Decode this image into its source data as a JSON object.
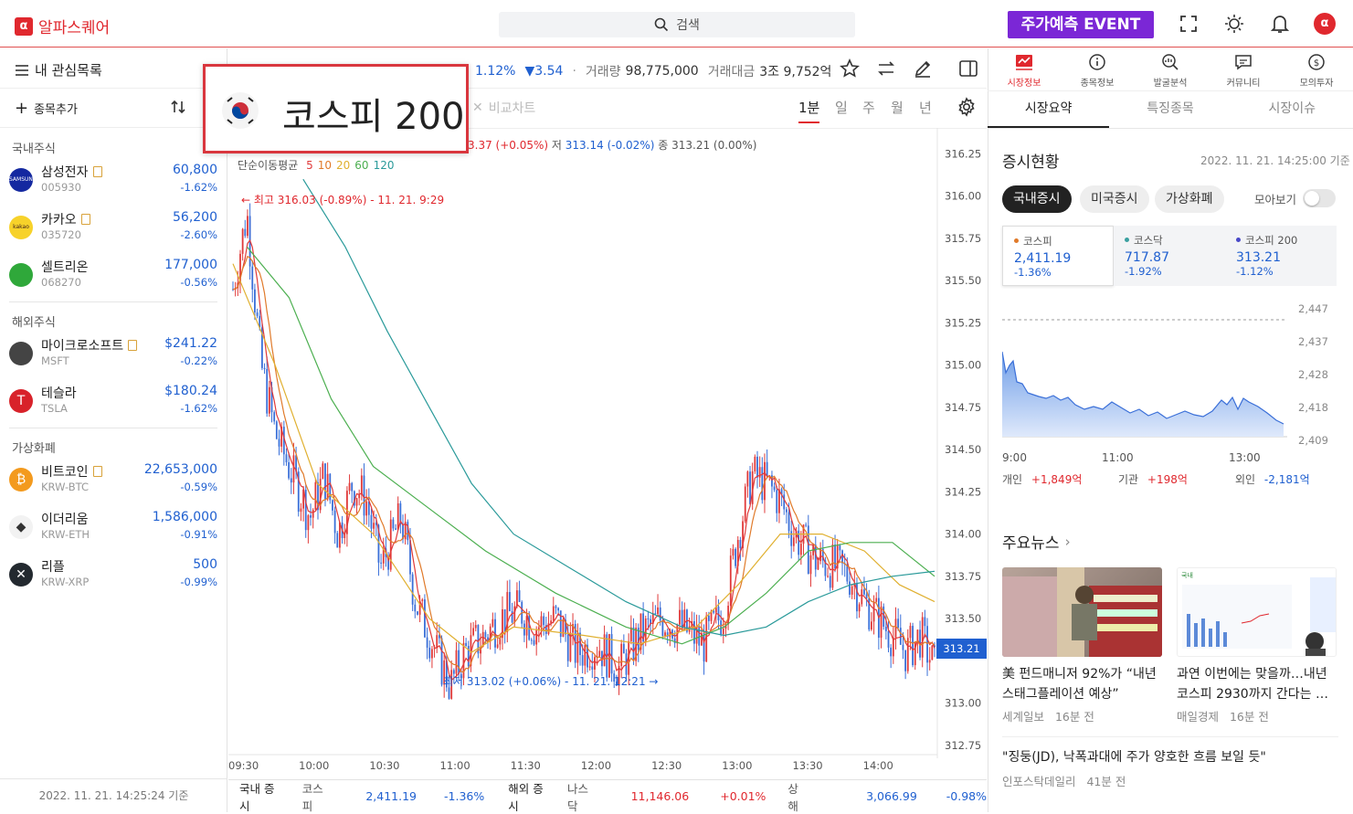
{
  "header": {
    "logo_label": "알파스퀘어",
    "logo_glyph": "α",
    "search_placeholder": "검색",
    "event_label": "주가예측 EVENT",
    "avatar_glyph": "α"
  },
  "watchlist": {
    "title": "내 관심목록",
    "add_label": "종목추가",
    "sections": [
      {
        "title": "국내주식",
        "items": [
          {
            "name": "삼성전자",
            "code": "005930",
            "price": "60,800",
            "change": "-1.62%",
            "logo_text": "SAMSUNG",
            "logo_color": "#1428a0",
            "doc": true
          },
          {
            "name": "카카오",
            "code": "035720",
            "price": "56,200",
            "change": "-2.60%",
            "logo_text": "kakao",
            "logo_color": "#f7d22a",
            "doc": true
          },
          {
            "name": "셀트리온",
            "code": "068270",
            "price": "177,000",
            "change": "-0.56%",
            "logo_text": "",
            "logo_color": "#2fa83a",
            "doc": false
          }
        ]
      },
      {
        "title": "해외주식",
        "items": [
          {
            "name": "마이크로소프트",
            "code": "MSFT",
            "price": "$241.22",
            "change": "-0.22%",
            "logo_text": "",
            "logo_color": "#444",
            "doc": true
          },
          {
            "name": "테슬라",
            "code": "TSLA",
            "price": "$180.24",
            "change": "-1.62%",
            "logo_text": "T",
            "logo_color": "#d8222a",
            "doc": false
          }
        ]
      },
      {
        "title": "가상화폐",
        "items": [
          {
            "name": "비트코인",
            "code": "KRW-BTC",
            "price": "22,653,000",
            "change": "-0.59%",
            "logo_text": "₿",
            "logo_color": "#f39a1e",
            "doc": true
          },
          {
            "name": "이더리움",
            "code": "KRW-ETH",
            "price": "1,586,000",
            "change": "-0.91%",
            "logo_text": "◆",
            "logo_color": "#f2f2f2",
            "doc": false
          },
          {
            "name": "리플",
            "code": "KRW-XRP",
            "price": "500",
            "change": "-0.99%",
            "logo_text": "✕",
            "logo_color": "#23292f",
            "doc": false
          }
        ]
      }
    ],
    "footer_time": "2022. 11. 21. 14:25:24 기준"
  },
  "chart_header": {
    "name": "코스피 200",
    "change_pct": "1.12%",
    "change_abs": "▼3.54",
    "volume_label": "거래량",
    "volume": "98,775,000",
    "value_label": "거래대금",
    "value": "3조 9,752억",
    "compare_label": "비교차트",
    "periods": [
      "1분",
      "일",
      "주",
      "월",
      "년"
    ],
    "active_period": "1분",
    "ohlc_text": "3.37 (+0.05%)",
    "low_label": "저",
    "low_text": "313.14 (-0.02%)",
    "close_label": "종",
    "close_text": "313.21 (0.00%)",
    "ma_label": "단순이동평균",
    "ma_periods": [
      "5",
      "10",
      "20",
      "60",
      "120"
    ],
    "ma_colors": [
      "#e03a3a",
      "#e07a2a",
      "#e0b030",
      "#4caf50",
      "#2a9a9a"
    ],
    "high_annotation": "← 최고 316.03 (-0.89%) - 11. 21. 9:29",
    "low_annotation": "최저 313.02 (+0.06%) - 11. 21. 12:21 →",
    "current_price_tag": "313.21"
  },
  "chart_data": {
    "type": "candlestick",
    "y_ticks": [
      "316.25",
      "316.00",
      "315.75",
      "315.50",
      "315.25",
      "315.00",
      "314.75",
      "314.50",
      "314.25",
      "314.00",
      "313.75",
      "313.50",
      "313.21",
      "313.00",
      "312.75"
    ],
    "x_ticks": [
      "09:30",
      "10:00",
      "10:30",
      "11:00",
      "11:30",
      "12:00",
      "12:30",
      "13:00",
      "13:30",
      "14:00"
    ],
    "ylim": [
      312.7,
      316.35
    ],
    "high": 316.03,
    "low": 313.02,
    "last": 313.21,
    "price_path": [
      [
        0,
        315.45
      ],
      [
        0.02,
        315.9
      ],
      [
        0.04,
        315.0
      ],
      [
        0.06,
        314.6
      ],
      [
        0.08,
        314.4
      ],
      [
        0.11,
        314.1
      ],
      [
        0.13,
        314.35
      ],
      [
        0.15,
        314.0
      ],
      [
        0.17,
        314.3
      ],
      [
        0.19,
        314.2
      ],
      [
        0.21,
        313.8
      ],
      [
        0.24,
        314.1
      ],
      [
        0.26,
        313.6
      ],
      [
        0.29,
        313.3
      ],
      [
        0.31,
        313.1
      ],
      [
        0.33,
        313.3
      ],
      [
        0.36,
        313.4
      ],
      [
        0.38,
        313.5
      ],
      [
        0.41,
        313.55
      ],
      [
        0.43,
        313.45
      ],
      [
        0.46,
        313.5
      ],
      [
        0.49,
        313.3
      ],
      [
        0.52,
        313.35
      ],
      [
        0.55,
        313.2
      ],
      [
        0.58,
        313.4
      ],
      [
        0.61,
        313.5
      ],
      [
        0.64,
        313.45
      ],
      [
        0.67,
        313.35
      ],
      [
        0.7,
        313.55
      ],
      [
        0.72,
        314.0
      ],
      [
        0.74,
        314.35
      ],
      [
        0.76,
        314.3
      ],
      [
        0.78,
        314.2
      ],
      [
        0.8,
        314.0
      ],
      [
        0.83,
        313.85
      ],
      [
        0.86,
        313.8
      ],
      [
        0.88,
        313.75
      ],
      [
        0.9,
        313.6
      ],
      [
        0.93,
        313.45
      ],
      [
        0.96,
        313.3
      ],
      [
        0.98,
        313.4
      ],
      [
        1,
        313.21
      ]
    ],
    "ma_paths": [
      {
        "name": "20",
        "color": "#e0b030",
        "points": [
          [
            0,
            315.6
          ],
          [
            0.06,
            315.0
          ],
          [
            0.12,
            314.3
          ],
          [
            0.2,
            314.0
          ],
          [
            0.28,
            313.5
          ],
          [
            0.34,
            313.3
          ],
          [
            0.4,
            313.45
          ],
          [
            0.5,
            313.4
          ],
          [
            0.58,
            313.35
          ],
          [
            0.66,
            313.45
          ],
          [
            0.72,
            313.7
          ],
          [
            0.78,
            314.0
          ],
          [
            0.84,
            314.0
          ],
          [
            0.9,
            313.9
          ],
          [
            0.95,
            313.7
          ],
          [
            1,
            313.6
          ]
        ]
      },
      {
        "name": "60",
        "color": "#4caf50",
        "points": [
          [
            0.02,
            315.7
          ],
          [
            0.08,
            315.4
          ],
          [
            0.14,
            314.8
          ],
          [
            0.2,
            314.4
          ],
          [
            0.28,
            314.15
          ],
          [
            0.36,
            313.9
          ],
          [
            0.46,
            313.65
          ],
          [
            0.56,
            313.45
          ],
          [
            0.64,
            313.35
          ],
          [
            0.7,
            313.45
          ],
          [
            0.76,
            313.65
          ],
          [
            0.82,
            313.9
          ],
          [
            0.88,
            313.95
          ],
          [
            0.94,
            313.95
          ],
          [
            1,
            313.75
          ]
        ]
      },
      {
        "name": "120",
        "color": "#2a9a9a",
        "points": [
          [
            0.1,
            316.1
          ],
          [
            0.16,
            315.7
          ],
          [
            0.22,
            315.2
          ],
          [
            0.28,
            314.75
          ],
          [
            0.34,
            314.3
          ],
          [
            0.4,
            314.0
          ],
          [
            0.48,
            313.8
          ],
          [
            0.56,
            313.6
          ],
          [
            0.64,
            313.45
          ],
          [
            0.7,
            313.4
          ],
          [
            0.76,
            313.45
          ],
          [
            0.82,
            313.6
          ],
          [
            0.88,
            313.7
          ],
          [
            0.94,
            313.75
          ],
          [
            1,
            313.78
          ]
        ]
      }
    ]
  },
  "bottom_bar": {
    "domestic_label": "국내 증시",
    "items": [
      {
        "name": "코스피",
        "value": "2,411.19",
        "change": "-1.36%",
        "color": "#2060d0"
      }
    ],
    "overseas_label": "해외 증시",
    "overseas_items": [
      {
        "name": "나스닥",
        "value": "11,146.06",
        "change": "+0.01%",
        "color": "#e0282e"
      },
      {
        "name": "상해",
        "value": "3,066.99",
        "change": "-0.98%",
        "color": "#2060d0"
      }
    ]
  },
  "right_panel": {
    "tabs": [
      "시장정보",
      "종목정보",
      "발굴분석",
      "커뮤니티",
      "모의투자"
    ],
    "sub_tabs": [
      "시장요약",
      "특징종목",
      "시장이슈"
    ],
    "market_title": "증시현황",
    "market_time": "2022. 11. 21. 14:25:00 기준",
    "pills": [
      "국내증시",
      "미국증시",
      "가상화폐"
    ],
    "collect_label": "모아보기",
    "indices": [
      {
        "name": "코스피",
        "value": "2,411.19",
        "change": "-1.36%",
        "dot": "#e07a2a"
      },
      {
        "name": "코스닥",
        "value": "717.87",
        "change": "-1.92%",
        "dot": "#3aa0a0"
      },
      {
        "name": "코스피 200",
        "value": "313.21",
        "change": "-1.12%",
        "dot": "#4848c8"
      }
    ],
    "mini_chart": {
      "y_ticks": [
        "2,447",
        "2,437",
        "2,428",
        "2,418",
        "2,409"
      ],
      "x_ticks": [
        "9:00",
        "11:00",
        "13:00"
      ]
    },
    "investors": [
      {
        "label": "개인",
        "value": "+1,849억",
        "color": "#e0282e"
      },
      {
        "label": "기관",
        "value": "+198억",
        "color": "#e0282e"
      },
      {
        "label": "외인",
        "value": "-2,181억",
        "color": "#2060d0"
      }
    ],
    "news_title": "주요뉴스",
    "news": [
      {
        "title": "美 펀드매니저 92%가 “내년 스태그플레이션 예상”",
        "source": "세계일보",
        "ago": "16분 전"
      },
      {
        "title": "과연 이번에는 맞을까…내년 코스피 2930까지 간다는 …",
        "source": "매일경제",
        "ago": "16분 전"
      },
      {
        "title": "\"징둥(JD), 낙폭과대에 주가 양호한 흐름 보일 듯\"",
        "source": "인포스탁데일리",
        "ago": "41분 전"
      }
    ],
    "thumb_label": "국내 주요뉴스"
  }
}
